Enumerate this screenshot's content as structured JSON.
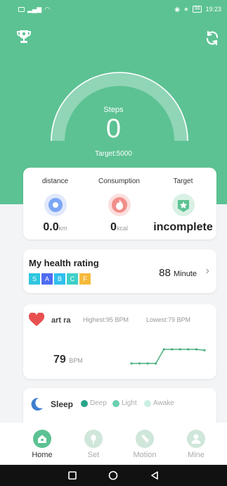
{
  "status_bar": {
    "time": "19:23",
    "battery": "98"
  },
  "colors": {
    "primary": "#5cc293",
    "heart": "#e8504f",
    "hr_line": "#4bb07f",
    "moon": "#3e7fd0"
  },
  "steps": {
    "label": "Steps",
    "value": "0",
    "target": "Target:5000"
  },
  "stats": [
    {
      "title": "distance",
      "value": "0.0",
      "unit": "km",
      "icon": "location-icon"
    },
    {
      "title": "Consumption",
      "value": "0",
      "unit": "kcal",
      "icon": "flame-icon"
    },
    {
      "title": "Target",
      "value": "incomplete",
      "unit": "",
      "icon": "star-icon"
    }
  ],
  "rating": {
    "title": "My health rating",
    "grades": [
      "S",
      "A",
      "B",
      "C",
      "F"
    ],
    "grade_colors": [
      "#2ec6de",
      "#4e6cf0",
      "#2fc0f0",
      "#3dd0c9",
      "#f5b93c"
    ],
    "value": "88",
    "unit": "Minute",
    "chevron": "›"
  },
  "heart_rate": {
    "title": "art ra",
    "highest": "Highest:95 BPM",
    "lowest": "Lowest:79 BPM",
    "value": "79",
    "unit": "BPM",
    "series": [
      79,
      79,
      79,
      79,
      95,
      95,
      95,
      95,
      95,
      94
    ]
  },
  "sleep": {
    "title": "Sleep",
    "legend": [
      {
        "label": "Deep",
        "color": "#2ba58a"
      },
      {
        "label": "Light",
        "color": "#6ccfb1"
      },
      {
        "label": "Awake",
        "color": "#c9efe1"
      }
    ]
  },
  "tabs": [
    {
      "label": "Home",
      "icon": "home-icon",
      "active": true
    },
    {
      "label": "Set",
      "icon": "settings-icon",
      "active": false
    },
    {
      "label": "Motion",
      "icon": "motion-icon",
      "active": false
    },
    {
      "label": "Mine",
      "icon": "profile-icon",
      "active": false
    }
  ]
}
